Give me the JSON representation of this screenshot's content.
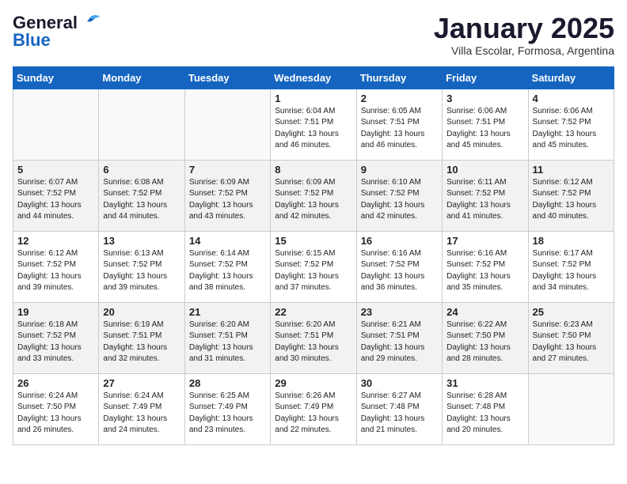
{
  "header": {
    "logo_general": "General",
    "logo_blue": "Blue",
    "title": "January 2025",
    "subtitle": "Villa Escolar, Formosa, Argentina"
  },
  "weekdays": [
    "Sunday",
    "Monday",
    "Tuesday",
    "Wednesday",
    "Thursday",
    "Friday",
    "Saturday"
  ],
  "weeks": [
    {
      "shaded": false,
      "days": [
        {
          "num": "",
          "info": ""
        },
        {
          "num": "",
          "info": ""
        },
        {
          "num": "",
          "info": ""
        },
        {
          "num": "1",
          "info": "Sunrise: 6:04 AM\nSunset: 7:51 PM\nDaylight: 13 hours\nand 46 minutes."
        },
        {
          "num": "2",
          "info": "Sunrise: 6:05 AM\nSunset: 7:51 PM\nDaylight: 13 hours\nand 46 minutes."
        },
        {
          "num": "3",
          "info": "Sunrise: 6:06 AM\nSunset: 7:51 PM\nDaylight: 13 hours\nand 45 minutes."
        },
        {
          "num": "4",
          "info": "Sunrise: 6:06 AM\nSunset: 7:52 PM\nDaylight: 13 hours\nand 45 minutes."
        }
      ]
    },
    {
      "shaded": true,
      "days": [
        {
          "num": "5",
          "info": "Sunrise: 6:07 AM\nSunset: 7:52 PM\nDaylight: 13 hours\nand 44 minutes."
        },
        {
          "num": "6",
          "info": "Sunrise: 6:08 AM\nSunset: 7:52 PM\nDaylight: 13 hours\nand 44 minutes."
        },
        {
          "num": "7",
          "info": "Sunrise: 6:09 AM\nSunset: 7:52 PM\nDaylight: 13 hours\nand 43 minutes."
        },
        {
          "num": "8",
          "info": "Sunrise: 6:09 AM\nSunset: 7:52 PM\nDaylight: 13 hours\nand 42 minutes."
        },
        {
          "num": "9",
          "info": "Sunrise: 6:10 AM\nSunset: 7:52 PM\nDaylight: 13 hours\nand 42 minutes."
        },
        {
          "num": "10",
          "info": "Sunrise: 6:11 AM\nSunset: 7:52 PM\nDaylight: 13 hours\nand 41 minutes."
        },
        {
          "num": "11",
          "info": "Sunrise: 6:12 AM\nSunset: 7:52 PM\nDaylight: 13 hours\nand 40 minutes."
        }
      ]
    },
    {
      "shaded": false,
      "days": [
        {
          "num": "12",
          "info": "Sunrise: 6:12 AM\nSunset: 7:52 PM\nDaylight: 13 hours\nand 39 minutes."
        },
        {
          "num": "13",
          "info": "Sunrise: 6:13 AM\nSunset: 7:52 PM\nDaylight: 13 hours\nand 39 minutes."
        },
        {
          "num": "14",
          "info": "Sunrise: 6:14 AM\nSunset: 7:52 PM\nDaylight: 13 hours\nand 38 minutes."
        },
        {
          "num": "15",
          "info": "Sunrise: 6:15 AM\nSunset: 7:52 PM\nDaylight: 13 hours\nand 37 minutes."
        },
        {
          "num": "16",
          "info": "Sunrise: 6:16 AM\nSunset: 7:52 PM\nDaylight: 13 hours\nand 36 minutes."
        },
        {
          "num": "17",
          "info": "Sunrise: 6:16 AM\nSunset: 7:52 PM\nDaylight: 13 hours\nand 35 minutes."
        },
        {
          "num": "18",
          "info": "Sunrise: 6:17 AM\nSunset: 7:52 PM\nDaylight: 13 hours\nand 34 minutes."
        }
      ]
    },
    {
      "shaded": true,
      "days": [
        {
          "num": "19",
          "info": "Sunrise: 6:18 AM\nSunset: 7:52 PM\nDaylight: 13 hours\nand 33 minutes."
        },
        {
          "num": "20",
          "info": "Sunrise: 6:19 AM\nSunset: 7:51 PM\nDaylight: 13 hours\nand 32 minutes."
        },
        {
          "num": "21",
          "info": "Sunrise: 6:20 AM\nSunset: 7:51 PM\nDaylight: 13 hours\nand 31 minutes."
        },
        {
          "num": "22",
          "info": "Sunrise: 6:20 AM\nSunset: 7:51 PM\nDaylight: 13 hours\nand 30 minutes."
        },
        {
          "num": "23",
          "info": "Sunrise: 6:21 AM\nSunset: 7:51 PM\nDaylight: 13 hours\nand 29 minutes."
        },
        {
          "num": "24",
          "info": "Sunrise: 6:22 AM\nSunset: 7:50 PM\nDaylight: 13 hours\nand 28 minutes."
        },
        {
          "num": "25",
          "info": "Sunrise: 6:23 AM\nSunset: 7:50 PM\nDaylight: 13 hours\nand 27 minutes."
        }
      ]
    },
    {
      "shaded": false,
      "days": [
        {
          "num": "26",
          "info": "Sunrise: 6:24 AM\nSunset: 7:50 PM\nDaylight: 13 hours\nand 26 minutes."
        },
        {
          "num": "27",
          "info": "Sunrise: 6:24 AM\nSunset: 7:49 PM\nDaylight: 13 hours\nand 24 minutes."
        },
        {
          "num": "28",
          "info": "Sunrise: 6:25 AM\nSunset: 7:49 PM\nDaylight: 13 hours\nand 23 minutes."
        },
        {
          "num": "29",
          "info": "Sunrise: 6:26 AM\nSunset: 7:49 PM\nDaylight: 13 hours\nand 22 minutes."
        },
        {
          "num": "30",
          "info": "Sunrise: 6:27 AM\nSunset: 7:48 PM\nDaylight: 13 hours\nand 21 minutes."
        },
        {
          "num": "31",
          "info": "Sunrise: 6:28 AM\nSunset: 7:48 PM\nDaylight: 13 hours\nand 20 minutes."
        },
        {
          "num": "",
          "info": ""
        }
      ]
    }
  ]
}
